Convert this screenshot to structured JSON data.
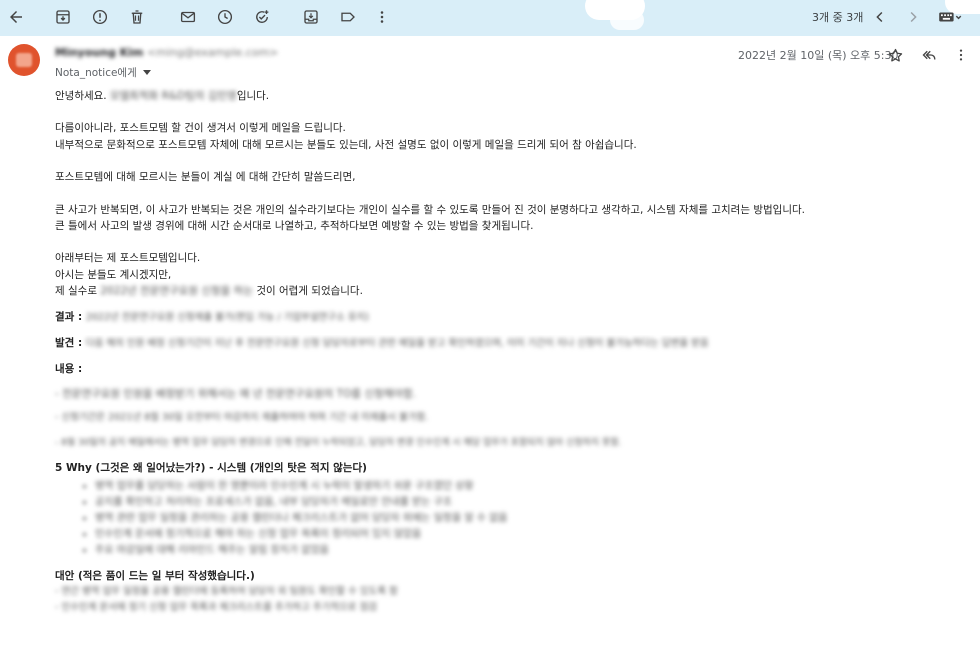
{
  "toolbar": {
    "icons": [
      "back-arrow-icon",
      "archive-icon",
      "report-spam-icon",
      "delete-icon",
      "mark-unread-icon",
      "snooze-icon",
      "add-task-icon",
      "move-to-icon",
      "label-icon",
      "more-vert-icon"
    ],
    "counter": "3개 중 3개",
    "nav_prev_icon": "chevron-left-icon",
    "nav_next_icon": "chevron-right-icon",
    "input_tools_icon": "keyboard-icon"
  },
  "header": {
    "sender_name": "Minyoung Kim",
    "sender_email": "<ming@example.com>",
    "to_label": "Nota_notice에게",
    "date": "2022년 2월 10일 (목) 오후 5:30"
  },
  "body": {
    "greeting_prefix": "안녕하세요. ",
    "greeting_blurred": "모델최적화 R&D팀의 김민영",
    "greeting_suffix": "입니다.",
    "p1_l1": "다름이아니라, 포스트모템 할 건이 생겨서 이렇게 메일을 드립니다.",
    "p1_l2": "내부적으로 문화적으로 포스트모템 자체에 대해 모르시는 분들도 있는데, 사전 설명도 없이 이렇게 메일을 드리게 되어 참 아쉽습니다.",
    "p2": "포스트모템에 대해 모르시는 분들이 계실 에 대해 간단히 말씀드리면,",
    "p3_l1": "큰 사고가 반복되면, 이 사고가 반복되는 것은 개인의 실수라기보다는 개인이 실수를 할 수 있도록 만들어 진 것이 분명하다고 생각하고, 시스템 자체를 고치려는 방법입니다.",
    "p3_l2": "큰 틀에서 사고의 발생 경위에 대해 시간 순서대로 나열하고, 추적하다보면 예방할 수 있는 방법을 찾게됩니다.",
    "p4_l1": "아래부터는 제 포스트모템입니다.",
    "p4_l2": "아시는 분들도 계시겠지만,",
    "p4_l3_prefix": "제 실수로 ",
    "p4_l3_blurred": "2022년 전문연구요원 신청을 하는",
    "p4_l3_suffix": " 것이 어렵게 되었습니다.",
    "result_label": "결과 : ",
    "result_blurred": "2022년 전문연구요원 신청제출 불가(편입 가능 / 기업부설연구소 유지)",
    "found_label": "발견 : ",
    "found_blurred": "다음 해의 인원 배정 신청기간이 지난 후 전문연구요원 신청 담당자로부터 관련 메일을 받고 확인하였으며, 이미 기간이 지나 신청이 불가능하다는 답변을 받음",
    "content_label": "내용 :",
    "content_l1": "- 전문연구요원 인원을 배정받기 위해서는 매 년 전문연구요원의 TO를 신청해야함.",
    "content_l2": "- 신청기간은 2021년 8월 30일 오전부터 마감까지 제출하여야 하며 기간 내 미제출시 불가함.",
    "content_l3": "- 8월 30일의 공지 메일에서는 병역 업무 담당자 변경으로 인해 전달이 누락되었고, 담당자 변경 인수인계 시 해당 업무가 포함되지 않아 신청하지 못함.",
    "why_title": "5 Why (그것은 왜 일어났는가?) - 시스템 (개인의 탓은 적지 않는다)",
    "why_items": [
      "병역 업무를 담당하는 사람이 한 명뿐이라 인수인계 시 누락이 발생하기 쉬운 구조였던 상황",
      "공지를 확인하고 처리하는 프로세스가 없음, 내부 담당자가 메일로만 안내를 받는 구조",
      "병역 관련 업무 일정을 관리하는 공용 캘린더나 체크리스트가 없어 담당자 외에는 일정을 알 수 없음",
      "인수인계 문서에 정기적으로 해야 하는 신청 업무 목록이 정리되어 있지 않았음",
      "주요 마감일에 대해 리마인드 해주는 알림 장치가 없었음"
    ],
    "alt_title": "대안 (적은 품이 드는 일 부터 작성했습니다.)",
    "alt_l1": "- 연간 병역 업무 일정을 공용 캘린더에 등록하여 담당자 외 팀원도 확인할 수 있도록 함",
    "alt_l2": "- 인수인계 문서에 정기 신청 업무 목록과 체크리스트를 추가하고 주기적으로 점검"
  }
}
